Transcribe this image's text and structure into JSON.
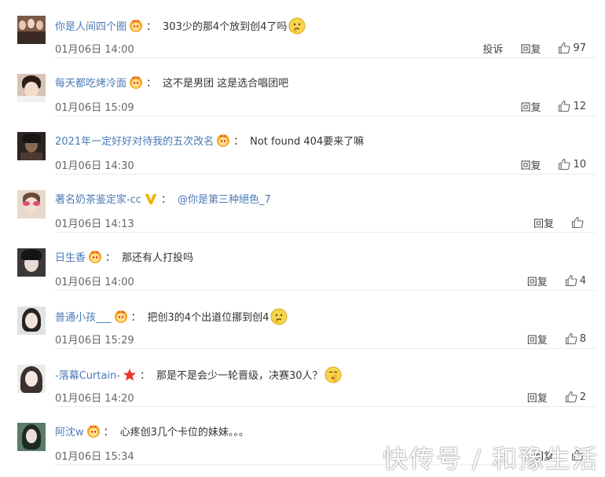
{
  "comments": [
    {
      "user": "你是人间四个圈",
      "badge": "crown-badge",
      "text": "303少的那4个放到创4了吗",
      "emoji": "thinking-emoji",
      "time": "01月06日 14:00",
      "report": "投诉",
      "reply": "回复",
      "likes": "97"
    },
    {
      "user": "每天都吃烤冷面",
      "badge": "crown-badge",
      "text": "这不是男团 这是选合唱团吧",
      "time": "01月06日 15:09",
      "reply": "回复",
      "likes": "12"
    },
    {
      "user": "2021年一定好好对待我的五次改名",
      "badge": "crown-badge",
      "text": "Not found 404要来了嘛",
      "time": "01月06日 14:30",
      "reply": "回复",
      "likes": "10"
    },
    {
      "user": "著名奶茶鉴定家-cc",
      "badge": "v-badge",
      "mention": "@你是第三种絕色_7",
      "time": "01月06日 14:13",
      "reply": "回复",
      "likes": ""
    },
    {
      "user": "日生香",
      "badge": "crown-badge",
      "text": "那还有人打投吗",
      "time": "01月06日 14:00",
      "reply": "回复",
      "likes": "4"
    },
    {
      "user": "普通小孩___",
      "badge": "crown-badge",
      "text": "把创3的4个出道位挪到创4",
      "emoji": "thinking-emoji",
      "time": "01月06日 15:29",
      "reply": "回复",
      "likes": "8"
    },
    {
      "user": "-落幕Curtain-",
      "badge": "star-badge",
      "text": "那是不是会少一轮晋级，决赛30人？",
      "emoji": "shush-emoji",
      "time": "01月06日 14:20",
      "reply": "回复",
      "likes": "2"
    },
    {
      "user": "阿沈w",
      "badge": "crown-badge",
      "text": "心疼创3几个卡位的妹妹。。。",
      "time": "01月06日 15:34",
      "reply": "回复",
      "likes": ""
    }
  ],
  "colon": "：",
  "watermark": "快传号 / 和豫生活",
  "colors": {
    "username": "#4a7ab7",
    "text": "#333333",
    "divider": "#ececec"
  }
}
